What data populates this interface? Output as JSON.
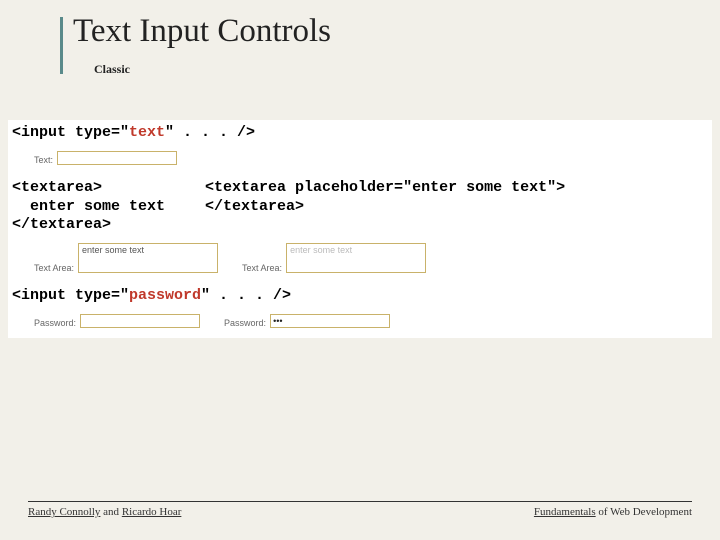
{
  "heading": "Text Input Controls",
  "subheading": "Classic",
  "code": {
    "inputText": {
      "pre": "<input type=\"",
      "val": "text",
      "post": "\" . . . />"
    },
    "textareaLeft": {
      "open": "<textarea>",
      "content": "  enter some text",
      "close": "</textarea>"
    },
    "textareaRight": {
      "open": "<textarea placeholder=\"enter some text\">",
      "close": "</textarea>"
    },
    "inputPassword": {
      "pre": "<input type=\"",
      "val": "password",
      "post": "\" . . . />"
    }
  },
  "examples": {
    "textLabel": "Text:",
    "textValue": "",
    "textAreaLabel": "Text Area:",
    "textAreaValue1": "enter some text",
    "textAreaValue2": "enter some text",
    "passwordLabel": "Password:",
    "passwordValue1": "",
    "passwordValue2": "•••"
  },
  "footer": {
    "leftA": "Randy Connolly",
    "leftMid": " and ",
    "leftB": "Ricardo Hoar",
    "rightA": "Fundamentals",
    "rightB": " of Web Development"
  }
}
